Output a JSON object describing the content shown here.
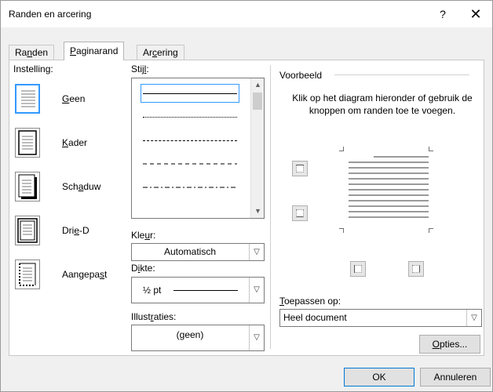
{
  "window": {
    "title": "Randen en arcering",
    "help": "?",
    "close": "✕"
  },
  "tabs": [
    {
      "label_pre": "Ra",
      "label_acc": "n",
      "label_post": "den",
      "active": false
    },
    {
      "label_pre": "",
      "label_acc": "P",
      "label_post": "aginarand",
      "active": true
    },
    {
      "label_pre": "Ar",
      "label_acc": "c",
      "label_post": "ering",
      "active": false
    }
  ],
  "setting": {
    "label": "Instelling:",
    "items": [
      {
        "pre": "",
        "acc": "G",
        "post": "een",
        "icon": "no-border-icon",
        "selected": true
      },
      {
        "pre": "",
        "acc": "K",
        "post": "ader",
        "icon": "box-border-icon",
        "selected": false
      },
      {
        "pre": "Sch",
        "acc": "a",
        "post": "duw",
        "icon": "shadow-border-icon",
        "selected": false
      },
      {
        "pre": "Dri",
        "acc": "e",
        "post": "-D",
        "icon": "3d-border-icon",
        "selected": false
      },
      {
        "pre": "Aangepa",
        "acc": "s",
        "post": "t",
        "icon": "custom-border-icon",
        "selected": false
      }
    ]
  },
  "style": {
    "label_pre": "Stij",
    "label_acc": "l",
    "label_post": ":"
  },
  "color": {
    "label_pre": "Kle",
    "label_acc": "u",
    "label_post": "r:",
    "value": "Automatisch"
  },
  "width": {
    "label_pre": "D",
    "label_acc": "i",
    "label_post": "kte:",
    "value": "½ pt"
  },
  "art": {
    "label_pre": "Illust",
    "label_acc": "r",
    "label_post": "aties:",
    "value": "(geen)"
  },
  "preview": {
    "label": "Voorbeeld",
    "hint": "Klik op het diagram hieronder of gebruik de knoppen om randen toe te voegen."
  },
  "apply": {
    "label_pre": "",
    "label_acc": "T",
    "label_post": "oepassen op:",
    "value": "Heel document"
  },
  "buttons": {
    "options_pre": "",
    "options_acc": "O",
    "options_post": "pties...",
    "ok": "OK",
    "cancel": "Annuleren"
  },
  "colors": {
    "accent": "#3399ff",
    "default_button_border": "#0078d7"
  }
}
